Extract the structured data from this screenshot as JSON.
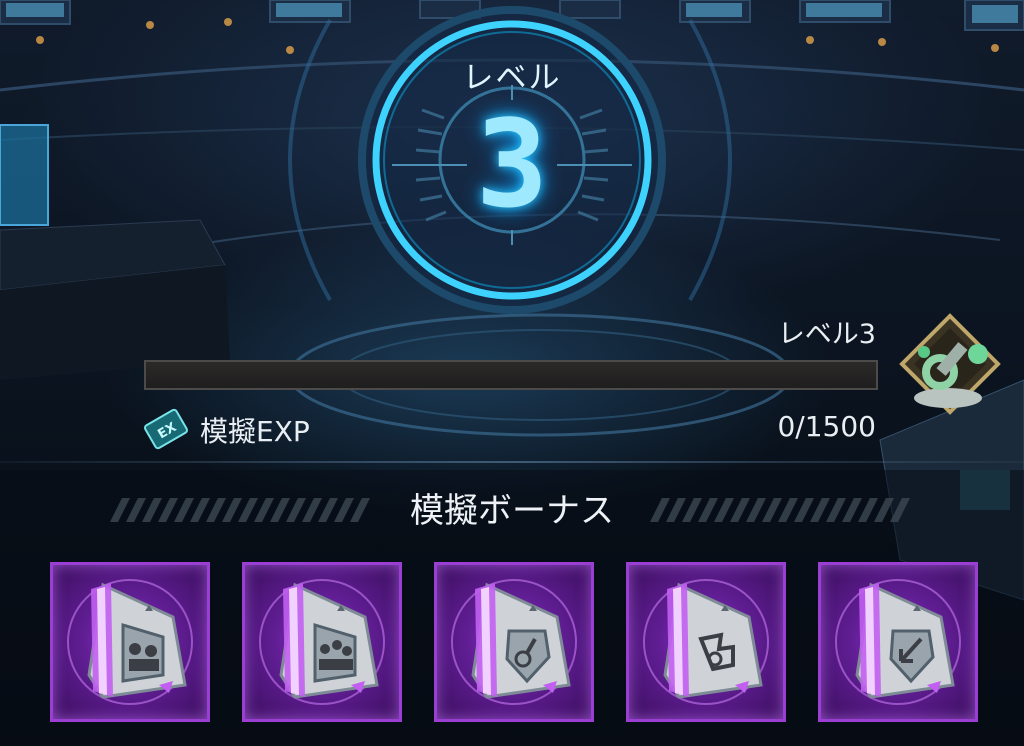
{
  "level_panel": {
    "title": "レベル",
    "number": "3",
    "right_label": "レベル3"
  },
  "progress": {
    "current": 0,
    "max": 1500,
    "value_text": "0/1500",
    "label": "模擬EXP"
  },
  "bonus": {
    "title": "模擬ボーナス",
    "cards": [
      {
        "icon": "team-bonus-icon"
      },
      {
        "icon": "squad-bonus-icon"
      },
      {
        "icon": "shield-bonus-icon"
      },
      {
        "icon": "mech-bonus-icon"
      },
      {
        "icon": "arrow-bonus-icon"
      }
    ]
  },
  "colors": {
    "accent_cyan": "#28c8ff",
    "card_purple": "#8d2fc3"
  }
}
